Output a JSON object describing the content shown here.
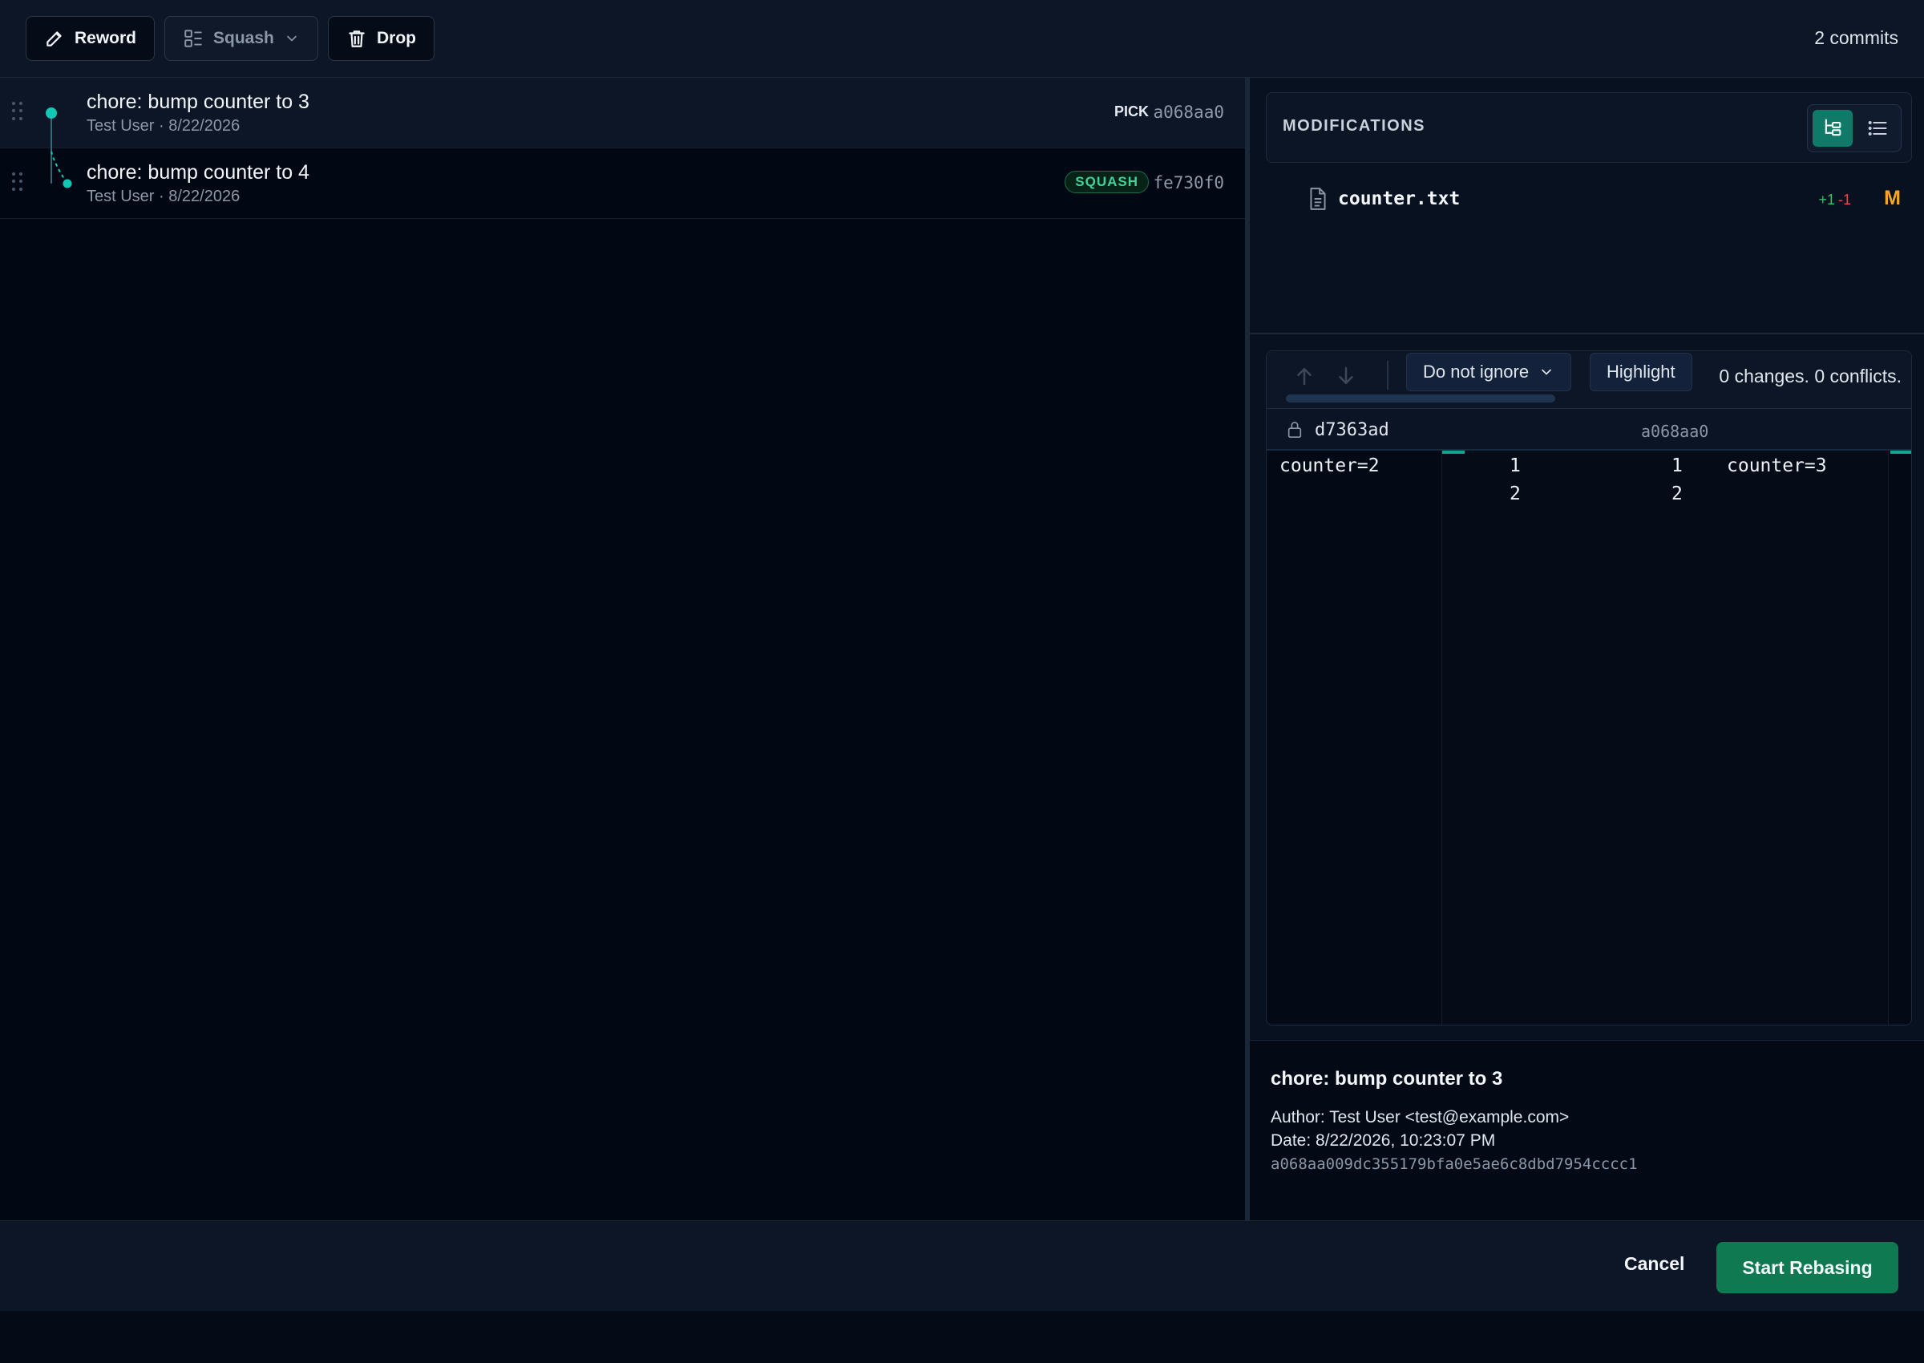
{
  "toolbar": {
    "reword_label": "Reword",
    "squash_label": "Squash",
    "drop_label": "Drop",
    "commit_count": "2 commits"
  },
  "commits": [
    {
      "title": "chore: bump counter to 3",
      "meta": "Test User · 8/22/2026",
      "action": "PICK",
      "hash": "a068aa0"
    },
    {
      "title": "chore: bump counter to 4",
      "meta": "Test User · 8/22/2026",
      "action": "SQUASH",
      "hash": "fe730f0"
    }
  ],
  "modifications": {
    "title": "MODIFICATIONS",
    "files": [
      {
        "name": "counter.txt",
        "added": "+1",
        "removed": "-1",
        "status": "M"
      }
    ]
  },
  "diff": {
    "whitespace_option": "Do not ignore",
    "highlight_option": "Highlight",
    "status": "0 changes. 0 conflicts.",
    "left_hash": "d7363ad",
    "right_hash": "a068aa0",
    "left_lines": [
      "counter=2"
    ],
    "right_lines": [
      "counter=3"
    ],
    "left_numbers": [
      "1",
      "2"
    ],
    "right_numbers": [
      "1",
      "2"
    ]
  },
  "commit_info": {
    "title": "chore: bump counter to 3",
    "author": "Author: Test User <test@example.com>",
    "date": "Date: 8/22/2026, 10:23:07 PM",
    "full_hash": "a068aa009dc355179bfa0e5ae6c8dbd7954cccc1"
  },
  "footer": {
    "cancel_label": "Cancel",
    "start_label": "Start Rebasing"
  },
  "colors": {
    "accent": "#12c7b4",
    "primary_button": "#0f7a52",
    "squash_badge": "#3ed39a",
    "added": "#31c46a",
    "removed": "#e5484d",
    "modified": "#f5a623"
  }
}
